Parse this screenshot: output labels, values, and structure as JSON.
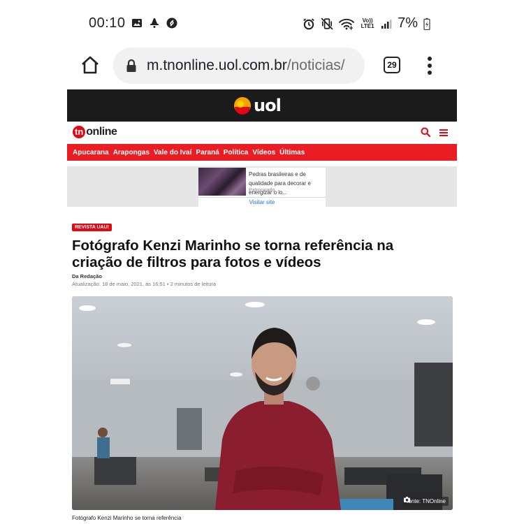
{
  "status_bar": {
    "time": "00:10",
    "battery": "7%",
    "network_label": "Vo))\nLTE1"
  },
  "browser": {
    "url_host": "m.tnonline.uol.com.br",
    "url_path": "/noticias/",
    "tab_count": "29"
  },
  "portal": {
    "name": "uol",
    "site_badge": "tn",
    "site_word": "online"
  },
  "nav": {
    "items": [
      "Apucarana",
      "Arapongas",
      "Vale do Ivaí",
      "Paraná",
      "Política",
      "Vídeos",
      "Últimas"
    ]
  },
  "ad": {
    "text": "Pedras brasileiras e de qualidade para decorar e energizar o lo...",
    "sponsor": "Patrocinado",
    "cta": "Visitar site"
  },
  "article": {
    "tag": "REVISTA UAU!",
    "headline": "Fotógrafo Kenzi Marinho se torna referência na criação de filtros para fotos e vídeos",
    "byline": "Da Redação",
    "meta": "Atualização: 18 de maio, 2021, às 16:51 • 2 minutos de leitura",
    "photo_credit": "fonte: TNOnline",
    "caption": "Fotógrafo Kenzi Marinho se torna referência"
  },
  "colors": {
    "accent_red": "#ea1d24",
    "uol_bar": "#1b1b1b"
  }
}
